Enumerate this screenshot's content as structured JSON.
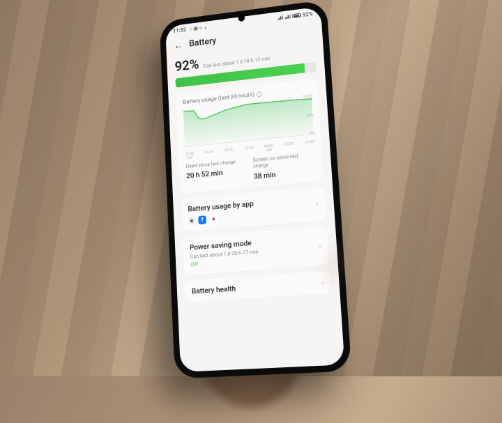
{
  "status": {
    "time": "11:52",
    "left_icons": "⏱ ⚫ ⚙ ▲",
    "battery_pct": "92%"
  },
  "header": {
    "title": "Battery"
  },
  "summary": {
    "percent": "92%",
    "estimate": "Can last about 1 d 18 h 13 min",
    "bar_fill_pct": 92
  },
  "usage_card": {
    "title": "Battery usage (last 24 hours)",
    "yticks": [
      "100%",
      "50%",
      "0%"
    ],
    "xticks": [
      "12:00\nPM",
      "04:00",
      "08:00",
      "12:00",
      "04:00\nAM",
      "08:00",
      "12:00"
    ],
    "stats": [
      {
        "label": "Used since last charge",
        "value": "20 h 52 min"
      },
      {
        "label": "Screen on since last charge",
        "value": "38 min"
      }
    ]
  },
  "usage_by_app": {
    "title": "Battery usage by app"
  },
  "power_saving": {
    "title": "Power saving mode",
    "subtitle": "Can last about 1 d 20 h 27 min",
    "state": "Off"
  },
  "battery_health": {
    "title": "Battery health"
  },
  "chart_data": {
    "type": "area",
    "x": [
      0,
      2,
      3,
      4,
      8,
      12,
      16,
      20,
      23,
      24
    ],
    "values": [
      96,
      95,
      72,
      70,
      88,
      97,
      96,
      95,
      93,
      92
    ],
    "ylim": [
      0,
      100
    ],
    "xlabel": "",
    "ylabel": "",
    "title": "Battery usage (last 24 hours)"
  },
  "colors": {
    "accent": "#4bd152"
  }
}
